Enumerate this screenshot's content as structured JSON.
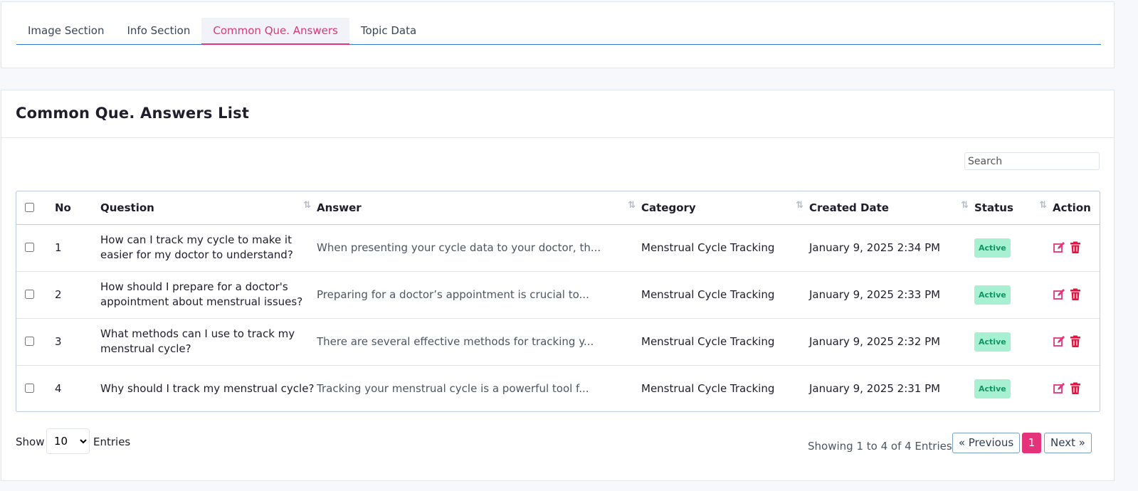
{
  "tabs": [
    {
      "label": "Image Section",
      "active": false
    },
    {
      "label": "Info Section",
      "active": false
    },
    {
      "label": "Common Que. Answers",
      "active": true
    },
    {
      "label": "Topic Data",
      "active": false
    }
  ],
  "card": {
    "title": "Common Que. Answers List"
  },
  "search": {
    "placeholder": "Search"
  },
  "table": {
    "headers": {
      "no": "No",
      "question": "Question",
      "answer": "Answer",
      "category": "Category",
      "created_date": "Created Date",
      "status": "Status",
      "action": "Action"
    },
    "rows": [
      {
        "no": "1",
        "question": "How can I track my cycle to make it easier for my doctor to understand?",
        "answer": "When presenting your cycle data to your doctor, th...",
        "category": "Menstrual Cycle Tracking",
        "created_date": "January 9, 2025 2:34 PM",
        "status": "Active"
      },
      {
        "no": "2",
        "question": "How should I prepare for a doctor's appointment about menstrual issues?",
        "answer": "Preparing for a doctor’s appointment is crucial to...",
        "category": "Menstrual Cycle Tracking",
        "created_date": "January 9, 2025 2:33 PM",
        "status": "Active"
      },
      {
        "no": "3",
        "question": "What methods can I use to track my menstrual cycle?",
        "answer": "There are several effective methods for tracking y...",
        "category": "Menstrual Cycle Tracking",
        "created_date": "January 9, 2025 2:32 PM",
        "status": "Active"
      },
      {
        "no": "4",
        "question": "Why should I track my menstrual cycle?",
        "answer": "Tracking your menstrual cycle is a powerful tool f...",
        "category": "Menstrual Cycle Tracking",
        "created_date": "January 9, 2025 2:31 PM",
        "status": "Active"
      }
    ]
  },
  "footer": {
    "show_label": "Show",
    "page_size": "10",
    "entries_label": "Entries",
    "info": "Showing 1 to 4 of 4 Entries",
    "prev_label": "« Previous",
    "current_page": "1",
    "next_label": "Next »"
  },
  "colors": {
    "accent": "#e4337a",
    "status_bg": "#a8f0d2",
    "status_text": "#0f9660",
    "tab_underline": "#2f7dd1",
    "edit_icon": "#e4337a",
    "delete_icon": "#e8103c"
  },
  "icons": {
    "edit": "edit-icon",
    "delete": "trash-icon",
    "sort": "sort-icon"
  }
}
